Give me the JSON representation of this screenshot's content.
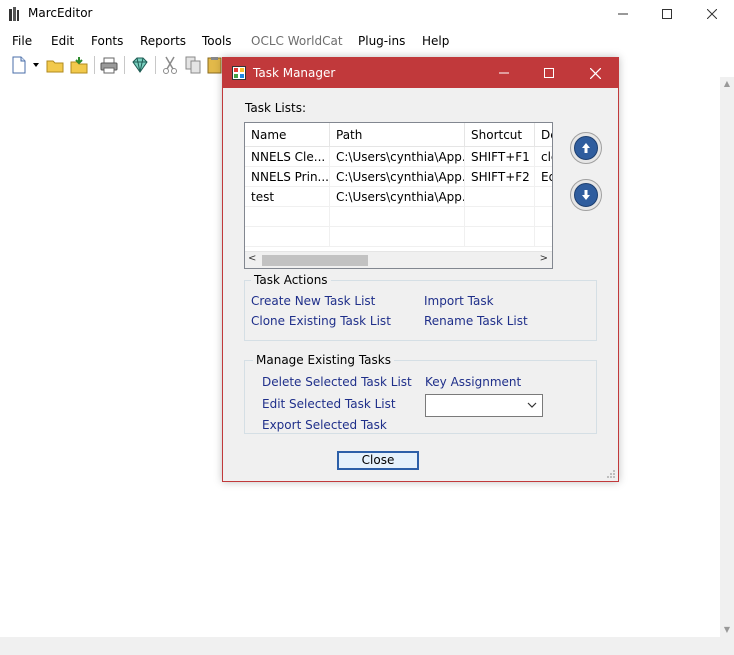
{
  "app": {
    "title": "MarcEditor"
  },
  "menu": [
    "File",
    "Edit",
    "Fonts",
    "Reports",
    "Tools",
    "OCLC WorldCat",
    "Plug-ins",
    "Help"
  ],
  "dialog": {
    "title": "Task Manager",
    "task_lists_label": "Task Lists:",
    "columns": [
      "Name",
      "Path",
      "Shortcut",
      "De"
    ],
    "rows": [
      [
        "NNELS Cle...",
        "C:\\Users\\cynthia\\App...",
        "SHIFT+F1",
        "cle"
      ],
      [
        "NNELS Prin...",
        "C:\\Users\\cynthia\\App...",
        "SHIFT+F2",
        "Ed"
      ],
      [
        "test",
        "C:\\Users\\cynthia\\App...",
        "",
        ""
      ]
    ],
    "task_actions": {
      "title": "Task Actions",
      "create": "Create New Task List",
      "import": "Import Task",
      "clone": "Clone Existing Task List",
      "rename": "Rename Task List"
    },
    "manage": {
      "title": "Manage Existing Tasks",
      "delete": "Delete Selected Task List",
      "key_assignment": "Key Assignment",
      "edit": "Edit Selected Task List",
      "export": "Export Selected Task",
      "combo_value": ""
    },
    "close_label": "Close"
  },
  "colors": {
    "dialog_accent": "#c1393b",
    "link": "#1f2f8a",
    "round_button": "#2f5d9e"
  }
}
